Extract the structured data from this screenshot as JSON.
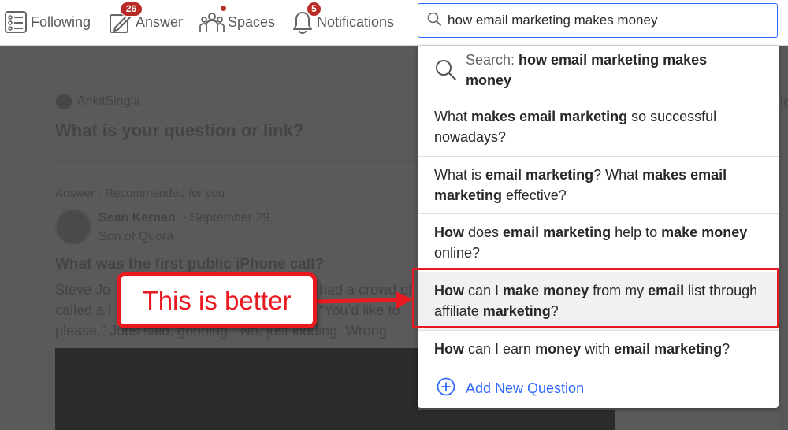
{
  "nav": {
    "following_label": "Following",
    "answer_label": "Answer",
    "answer_badge": "26",
    "spaces_label": "Spaces",
    "notifications_label": "Notifications",
    "notifications_badge": "5"
  },
  "search": {
    "value": "how email marketing makes money"
  },
  "feed": {
    "author": "AnkitSingla",
    "prompt": "What is your question or link?",
    "recommendation": "Answer · Recommended for you",
    "answerer": "Sean Kernan",
    "answer_date": "· September 29",
    "answerer_credential": "Son of Quora",
    "question": "What was the first public iPhone call?",
    "body_line1": "Steve Jo",
    "body_line1_end": "had a crowd of",
    "body_line2": "called a l",
    "body_line2_end": "“You’d like to",
    "body_line3": "please,” Jobs said, grinning. “No, just kidding. Wrong",
    "right_fragment": "ic"
  },
  "dropdown": {
    "search_prefix": "Search: ",
    "search_query": "how email marketing makes money",
    "suggestions": [
      {
        "parts": [
          "What ",
          "makes email marketing",
          " so successful nowadays?"
        ]
      },
      {
        "parts": [
          "What is ",
          "email marketing",
          "? What ",
          "makes email marketing",
          " effective?"
        ]
      },
      {
        "parts": [
          "How",
          " does ",
          "email marketing",
          " help to ",
          "make money",
          " online?"
        ]
      },
      {
        "parts": [
          "How",
          " can I ",
          "make money",
          " from my ",
          "email",
          " list through affiliate ",
          "marketing",
          "?"
        ]
      },
      {
        "parts": [
          "How",
          " can I earn ",
          "money",
          " with ",
          "email marketing",
          "?"
        ]
      }
    ],
    "add_label": "Add New Question"
  },
  "annotation": {
    "callout_text": "This is better",
    "color": "#e8191f"
  },
  "colors": {
    "accent": "#2e69ff",
    "brand": "#b92b27"
  }
}
